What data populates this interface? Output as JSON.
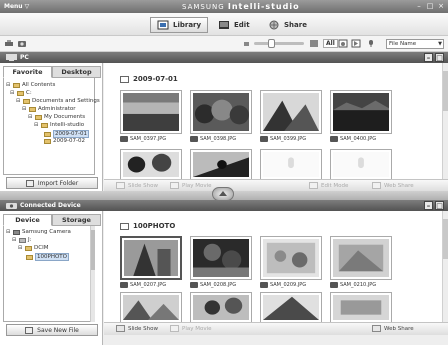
{
  "titlebar": {
    "menu": "Menu ▽",
    "brand_maker": "SAMSUNG",
    "brand_app": "Intelli-studio",
    "win_min": "–",
    "win_max": "□",
    "win_close": "×"
  },
  "modes": {
    "library": "Library",
    "edit": "Edit",
    "share": "Share"
  },
  "toolbar2": {
    "all": "All",
    "sort": "File Name"
  },
  "pc": {
    "header": "PC",
    "tabs": [
      "Favorite",
      "Desktop"
    ],
    "tree": [
      "All Contents",
      "C:",
      "Documents and Settings",
      "Administrator",
      "My Documents",
      "Intelli-studio",
      "2009-07-01",
      "2009-07-02"
    ],
    "import_button": "Import Folder",
    "folder_title": "2009-07-01",
    "thumbs": [
      "SAM_0397.JPG",
      "SAM_0398.JPG",
      "SAM_0399.JPG",
      "SAM_0400.JPG"
    ],
    "actions": {
      "slide_show": "Slide Show",
      "play_movie": "Play Movie",
      "edit_mode": "Edit Mode",
      "web_share": "Web Share"
    }
  },
  "device": {
    "header": "Connected Device",
    "tabs": [
      "Device",
      "Storage"
    ],
    "tree": [
      "Samsung Camera",
      "J:",
      "DCIM",
      "100PHOTO"
    ],
    "save_button": "Save New File",
    "folder_title": "100PHOTO",
    "thumbs": [
      "SAM_0207.JPG",
      "SAM_0208.JPG",
      "SAM_0209.JPG",
      "SAM_0210.JPG"
    ],
    "actions": {
      "slide_show": "Slide Show",
      "play_movie": "Play Movie",
      "web_share": "Web Share"
    }
  }
}
